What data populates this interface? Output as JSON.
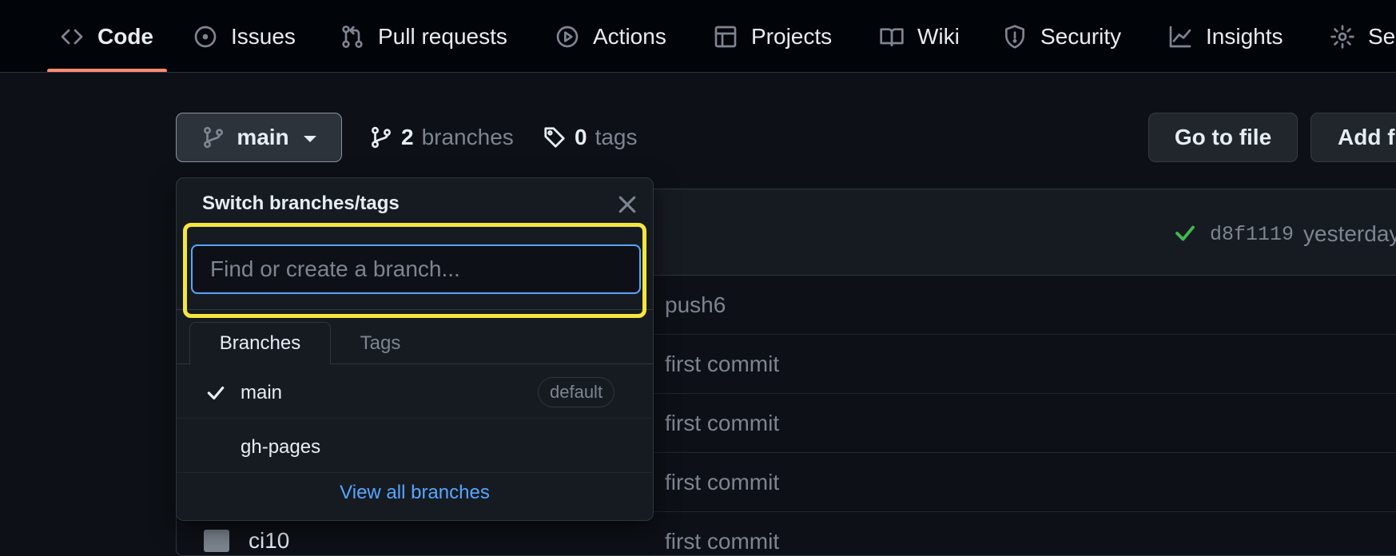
{
  "repo_nav": {
    "tabs": [
      {
        "label": "Code",
        "icon": "code-icon",
        "active": true
      },
      {
        "label": "Issues",
        "icon": "issue-circle-icon"
      },
      {
        "label": "Pull requests",
        "icon": "pull-request-icon"
      },
      {
        "label": "Actions",
        "icon": "play-circle-icon"
      },
      {
        "label": "Projects",
        "icon": "table-icon"
      },
      {
        "label": "Wiki",
        "icon": "book-icon"
      },
      {
        "label": "Security",
        "icon": "shield-icon"
      },
      {
        "label": "Insights",
        "icon": "graph-icon"
      },
      {
        "label": "Se",
        "icon": "gear-icon"
      }
    ],
    "active_underline_color": "#fd8c73"
  },
  "toolbar": {
    "branch_button_label": "main",
    "branches_count": "2",
    "branches_label": "branches",
    "tags_count": "0",
    "tags_label": "tags",
    "go_to_file_label": "Go to file",
    "add_file_label": "Add fi"
  },
  "latest_commit": {
    "status_icon": "check-icon",
    "sha": "d8f1119",
    "time": "yesterday"
  },
  "file_rows": [
    {
      "message": "push6"
    },
    {
      "message": "first commit"
    },
    {
      "message": "first commit"
    },
    {
      "message": "first commit"
    },
    {
      "name": "ci10",
      "message": "first commit"
    }
  ],
  "branch_popover": {
    "title": "Switch branches/tags",
    "search_placeholder": "Find or create a branch...",
    "tabs": [
      "Branches",
      "Tags"
    ],
    "branches": [
      {
        "name": "main",
        "selected": true,
        "badge": "default"
      },
      {
        "name": "gh-pages",
        "selected": false
      }
    ],
    "view_all_label": "View all branches",
    "highlight_color": "#f5e63f",
    "link_color": "#58a6ff"
  }
}
